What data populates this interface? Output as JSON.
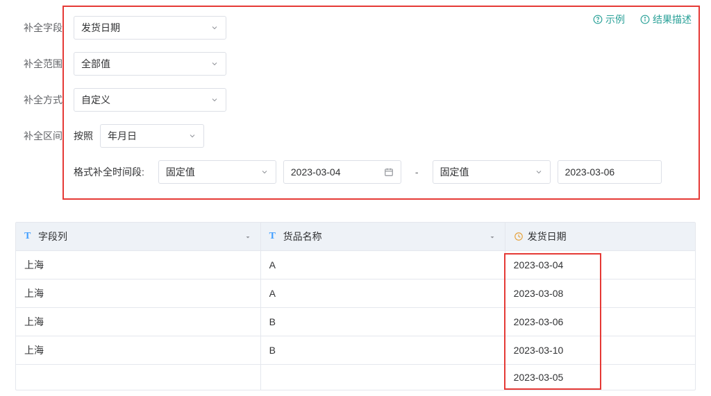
{
  "labels": {
    "field": "补全字段",
    "scope": "补全范围",
    "method": "补全方式",
    "interval": "补全区间",
    "interval_by": "按照",
    "format_range": "格式补全时间段:"
  },
  "selects": {
    "field_value": "发货日期",
    "scope_value": "全部值",
    "method_value": "自定义",
    "interval_unit": "年月日",
    "range_start_type": "固定值",
    "range_start_date": "2023-03-04",
    "range_end_type": "固定值",
    "range_end_date": "2023-03-06"
  },
  "links": {
    "example": "示例",
    "result_desc": "结果描述"
  },
  "table": {
    "headers": {
      "col1": "字段列",
      "col2": "货品名称",
      "col3": "发货日期"
    },
    "rows": [
      {
        "c1": "上海",
        "c2": "A",
        "c3": "2023-03-04"
      },
      {
        "c1": "上海",
        "c2": "A",
        "c3": "2023-03-08"
      },
      {
        "c1": "上海",
        "c2": "B",
        "c3": "2023-03-06"
      },
      {
        "c1": "上海",
        "c2": "B",
        "c3": "2023-03-10"
      },
      {
        "c1": "",
        "c2": "",
        "c3": "2023-03-05"
      }
    ]
  }
}
